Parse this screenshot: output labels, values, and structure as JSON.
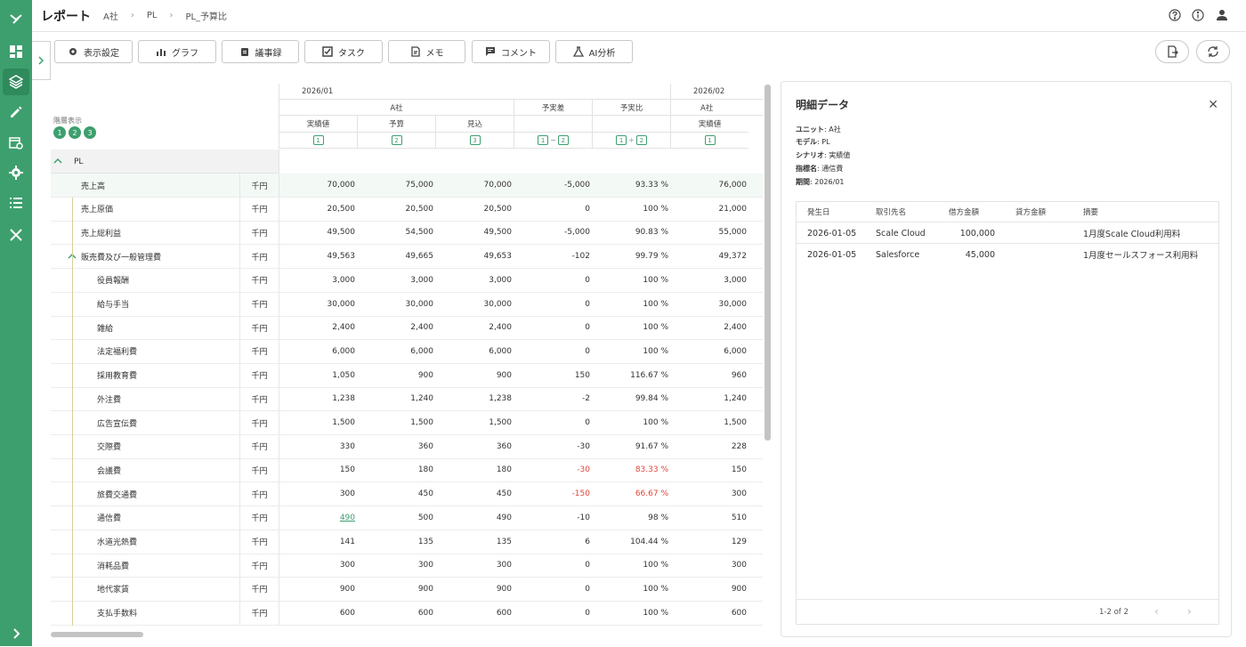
{
  "header": {
    "title": "レポート",
    "breadcrumbs": [
      "A社",
      "PL",
      "PL_予算比"
    ]
  },
  "toolbar": {
    "buttons": [
      {
        "label": "表示設定",
        "icon": "gear-icon"
      },
      {
        "label": "グラフ",
        "icon": "bar-chart-icon"
      },
      {
        "label": "議事録",
        "icon": "clipboard-icon"
      },
      {
        "label": "タスク",
        "icon": "checkbox-icon"
      },
      {
        "label": "メモ",
        "icon": "memo-icon"
      },
      {
        "label": "コメント",
        "icon": "comment-icon"
      },
      {
        "label": "AI分析",
        "icon": "ai-flask-icon"
      }
    ]
  },
  "grid": {
    "hierarchy_label": "階層表示",
    "hierarchy_levels": [
      "1",
      "2",
      "3"
    ],
    "period1": "2026/01",
    "period2": "2026/02",
    "company": "A社",
    "col_actual": "実績値",
    "col_budget": "予算",
    "col_forecast": "見込",
    "col_diff": "予実差",
    "col_ratio": "予実比",
    "badge1": "1",
    "badge2": "2",
    "badge3": "3",
    "op_minus": "−",
    "op_div": "÷",
    "group_label": "PL",
    "rows": [
      {
        "label": "売上高",
        "unit": "千円",
        "actual": "70,000",
        "budget": "75,000",
        "forecast": "70,000",
        "diff": "-5,000",
        "ratio": "93.33 %",
        "next": "76,000"
      },
      {
        "label": "売上原価",
        "unit": "千円",
        "actual": "20,500",
        "budget": "20,500",
        "forecast": "20,500",
        "diff": "0",
        "ratio": "100 %",
        "next": "21,000"
      },
      {
        "label": "売上総利益",
        "unit": "千円",
        "actual": "49,500",
        "budget": "54,500",
        "forecast": "49,500",
        "diff": "-5,000",
        "ratio": "90.83 %",
        "next": "55,000"
      },
      {
        "label": "販売費及び一般管理費",
        "unit": "千円",
        "actual": "49,563",
        "budget": "49,665",
        "forecast": "49,653",
        "diff": "-102",
        "ratio": "99.79 %",
        "next": "49,372"
      },
      {
        "label": "役員報酬",
        "unit": "千円",
        "actual": "3,000",
        "budget": "3,000",
        "forecast": "3,000",
        "diff": "0",
        "ratio": "100 %",
        "next": "3,000"
      },
      {
        "label": "給与手当",
        "unit": "千円",
        "actual": "30,000",
        "budget": "30,000",
        "forecast": "30,000",
        "diff": "0",
        "ratio": "100 %",
        "next": "30,000"
      },
      {
        "label": "雑給",
        "unit": "千円",
        "actual": "2,400",
        "budget": "2,400",
        "forecast": "2,400",
        "diff": "0",
        "ratio": "100 %",
        "next": "2,400"
      },
      {
        "label": "法定福利費",
        "unit": "千円",
        "actual": "6,000",
        "budget": "6,000",
        "forecast": "6,000",
        "diff": "0",
        "ratio": "100 %",
        "next": "6,000"
      },
      {
        "label": "採用教育費",
        "unit": "千円",
        "actual": "1,050",
        "budget": "900",
        "forecast": "900",
        "diff": "150",
        "ratio": "116.67 %",
        "next": "960"
      },
      {
        "label": "外注費",
        "unit": "千円",
        "actual": "1,238",
        "budget": "1,240",
        "forecast": "1,238",
        "diff": "-2",
        "ratio": "99.84 %",
        "next": "1,240"
      },
      {
        "label": "広告宣伝費",
        "unit": "千円",
        "actual": "1,500",
        "budget": "1,500",
        "forecast": "1,500",
        "diff": "0",
        "ratio": "100 %",
        "next": "1,500"
      },
      {
        "label": "交際費",
        "unit": "千円",
        "actual": "330",
        "budget": "360",
        "forecast": "360",
        "diff": "-30",
        "ratio": "91.67 %",
        "next": "228"
      },
      {
        "label": "会議費",
        "unit": "千円",
        "actual": "150",
        "budget": "180",
        "forecast": "180",
        "diff": "-30",
        "ratio": "83.33 %",
        "next": "150"
      },
      {
        "label": "旅費交通費",
        "unit": "千円",
        "actual": "300",
        "budget": "450",
        "forecast": "450",
        "diff": "-150",
        "ratio": "66.67 %",
        "next": "300"
      },
      {
        "label": "通信費",
        "unit": "千円",
        "actual": "490",
        "budget": "500",
        "forecast": "490",
        "diff": "-10",
        "ratio": "98 %",
        "next": "510"
      },
      {
        "label": "水道光熱費",
        "unit": "千円",
        "actual": "141",
        "budget": "135",
        "forecast": "135",
        "diff": "6",
        "ratio": "104.44 %",
        "next": "129"
      },
      {
        "label": "消耗品費",
        "unit": "千円",
        "actual": "300",
        "budget": "300",
        "forecast": "300",
        "diff": "0",
        "ratio": "100 %",
        "next": "300"
      },
      {
        "label": "地代家賃",
        "unit": "千円",
        "actual": "900",
        "budget": "900",
        "forecast": "900",
        "diff": "0",
        "ratio": "100 %",
        "next": "900"
      },
      {
        "label": "支払手数料",
        "unit": "千円",
        "actual": "600",
        "budget": "600",
        "forecast": "600",
        "diff": "0",
        "ratio": "100 %",
        "next": "600"
      }
    ]
  },
  "panel": {
    "title": "明細データ",
    "unit_key": "ユニット",
    "unit_val": "A社",
    "model_key": "モデル",
    "model_val": "PL",
    "scenario_key": "シナリオ",
    "scenario_val": "実績値",
    "metric_key": "指標名",
    "metric_val": "通信費",
    "period_key": "期間",
    "period_val": "2026/01",
    "columns": [
      "発生日",
      "取引先名",
      "借方金額",
      "貸方金額",
      "摘要"
    ],
    "rows": [
      {
        "date": "2026-01-05",
        "vendor": "Scale Cloud",
        "debit": "100,000",
        "credit": "",
        "memo": "1月度Scale Cloud利用料"
      },
      {
        "date": "2026-01-05",
        "vendor": "Salesforce",
        "debit": "45,000",
        "credit": "",
        "memo": "1月度セールスフォース利用料"
      }
    ],
    "pagination": "1-2 of 2"
  },
  "colors": {
    "accent": "#3e9f6e",
    "negative": "#e0463a"
  }
}
